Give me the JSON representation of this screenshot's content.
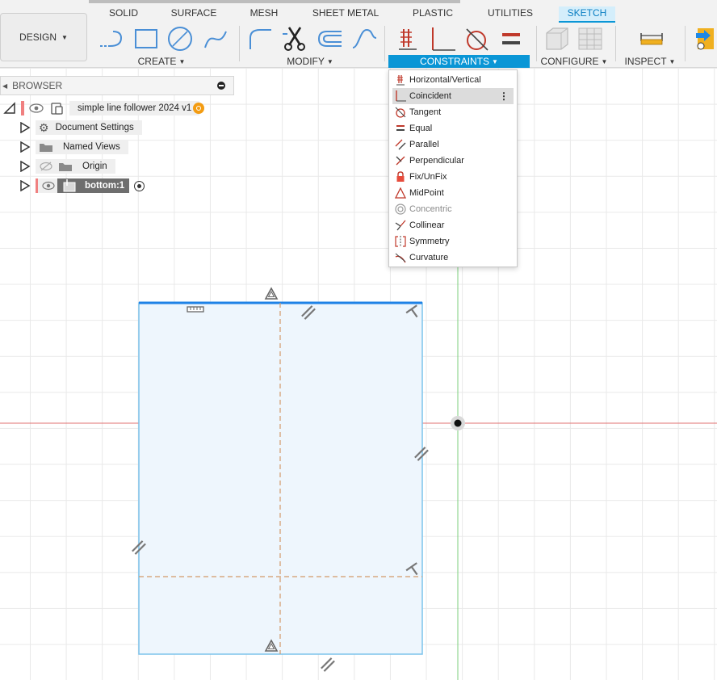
{
  "workspace": {
    "label": "DESIGN"
  },
  "tabs": [
    {
      "label": "SOLID"
    },
    {
      "label": "SURFACE"
    },
    {
      "label": "MESH"
    },
    {
      "label": "SHEET METAL"
    },
    {
      "label": "PLASTIC"
    },
    {
      "label": "UTILITIES"
    },
    {
      "label": "SKETCH"
    }
  ],
  "groups": {
    "create": "CREATE",
    "modify": "MODIFY",
    "constraints": "CONSTRAINTS",
    "configure": "CONFIGURE",
    "inspect": "INSPECT"
  },
  "browser": {
    "title": "BROWSER",
    "root": "simple line follower 2024 v1",
    "items": [
      {
        "label": "Document Settings"
      },
      {
        "label": "Named Views"
      },
      {
        "label": "Origin"
      },
      {
        "label": "bottom:1"
      }
    ]
  },
  "constraint_menu": {
    "items": [
      {
        "label": "Horizontal/Vertical",
        "icon": "horizontal-vertical-icon"
      },
      {
        "label": "Coincident",
        "icon": "coincident-icon"
      },
      {
        "label": "Tangent",
        "icon": "tangent-icon"
      },
      {
        "label": "Equal",
        "icon": "equal-icon"
      },
      {
        "label": "Parallel",
        "icon": "parallel-icon"
      },
      {
        "label": "Perpendicular",
        "icon": "perpendicular-icon"
      },
      {
        "label": "Fix/UnFix",
        "icon": "lock-icon"
      },
      {
        "label": "MidPoint",
        "icon": "midpoint-icon"
      },
      {
        "label": "Concentric",
        "icon": "concentric-icon"
      },
      {
        "label": "Collinear",
        "icon": "collinear-icon"
      },
      {
        "label": "Symmetry",
        "icon": "symmetry-icon"
      },
      {
        "label": "Curvature",
        "icon": "curvature-icon"
      }
    ],
    "more_glyph": "⋮"
  },
  "colors": {
    "accent": "#0a96d6",
    "constraint_red": "#c0392b",
    "sketch_fill": "#eef6fd",
    "sketch_edge": "#7cc3ec",
    "selected_edge": "#1e82e6",
    "x_axis": "#e07070",
    "y_axis": "#7ccf7c",
    "construction_line": "#d39a6a"
  }
}
